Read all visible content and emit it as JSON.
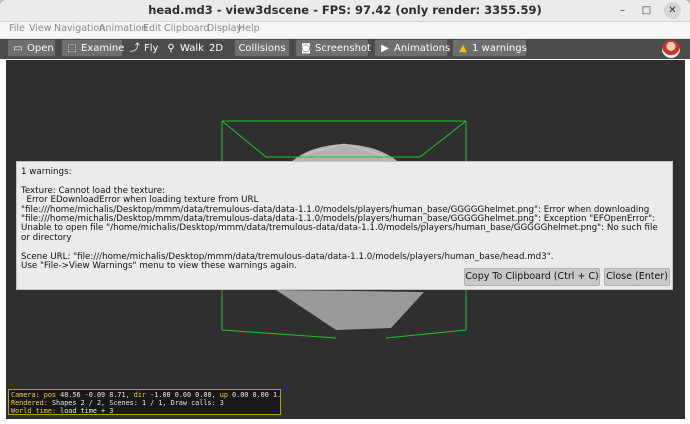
{
  "window": {
    "title": "head.md3 - view3dscene - FPS: 97.42 (only render: 3355.59)",
    "minimize_icon": "–",
    "maximize_icon": "□",
    "close_icon": "✕"
  },
  "menubar": [
    "File",
    "View",
    "Navigation",
    "Animation",
    "Edit",
    "Clipboard",
    "Display",
    "Help"
  ],
  "toolbar": {
    "open": "Open",
    "examine": "Examine",
    "fly": "Fly",
    "walk": "Walk",
    "twod": "2D",
    "collisions": "Collisions",
    "screenshot": "Screenshot",
    "animations": "Animations",
    "warnings": "1 warnings",
    "icons": {
      "open": "folder-icon",
      "examine": "cube-icon",
      "fly": "fly-icon",
      "walk": "walk-icon",
      "screenshot": "camera-icon",
      "animations": "play-icon",
      "warnings": "warning-icon"
    }
  },
  "dialog": {
    "heading": "1 warnings:",
    "line1": "Texture: Cannot load the texture:",
    "line2": "  Error EDownloadError when loading texture from URL",
    "line3": "\"file:///home/michalis/Desktop/mmm/data/tremulous-data/data-1.1.0/models/players/human_base/GGGGGhelmet.png\": Error when downloading",
    "line4": "\"file:///home/michalis/Desktop/mmm/data/tremulous-data/data-1.1.0/models/players/human_base/GGGGGhelmet.png\": Exception \"EFOpenError\":",
    "line5": "Unable to open file \"/home/michalis/Desktop/mmm/data/tremulous-data/data-1.1.0/models/players/human_base/GGGGGhelmet.png\": No such file",
    "line6": "or directory",
    "line7": "Scene URL: \"file:///home/michalis/Desktop/mmm/data/tremulous-data/data-1.1.0/models/players/human_base/head.md3\".",
    "line8": "Use \"File->View Warnings\" menu to view these warnings again.",
    "copy_button": "Copy To Clipboard (Ctrl + C)",
    "close_button": "Close (Enter)"
  },
  "status": {
    "camera_label": "Camera:",
    "pos_label": "pos",
    "pos": "48.56 -0.09 8.71,",
    "dir_label": "dir",
    "dir": "-1.00 0.00 0.00,",
    "up_label": "up",
    "up": "0.00 0.00 1.00",
    "rendered_label": "Rendered:",
    "rendered": "Shapes 2 / 2, Scenes: 1 / 1, Draw calls: 3",
    "world_time_label": "World time:",
    "world_time": "load time + 3"
  },
  "colors": {
    "bbox_green": "#22c22a",
    "toolbar_bg": "#4b4b4b",
    "viewport_bg": "#2f2f2f",
    "status_border": "#b9a000"
  }
}
